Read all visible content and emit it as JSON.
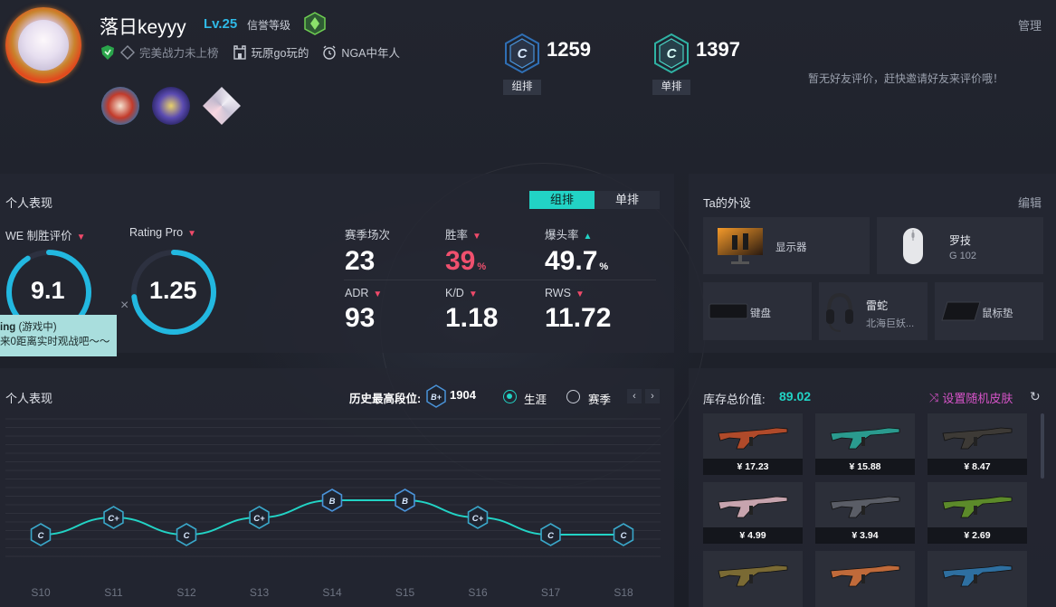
{
  "profile": {
    "username": "落日keyyy",
    "level": "Lv.25",
    "credit_label": "信誉等级",
    "tags": [
      {
        "icon": "shield-green-icon",
        "text": "完美战力未上榜"
      },
      {
        "icon": "fort-icon",
        "text": "玩原go玩的"
      },
      {
        "icon": "alarm-icon",
        "text": "NGA中年人"
      }
    ],
    "badges": [
      "opera-mask-badge",
      "planet-badge",
      "diamond-badge"
    ],
    "manage": "管理",
    "friend_eval": "暂无好友评价，赶快邀请好友来评价哦！"
  },
  "ranks": {
    "group": {
      "grade": "C",
      "score": "1259",
      "tag": "组排"
    },
    "solo": {
      "grade": "C",
      "score": "1397",
      "tag": "单排"
    }
  },
  "performance": {
    "title": "个人表现",
    "tabs": {
      "active": "组排",
      "inactive": "单排"
    },
    "we_label": "WE 制胜评价",
    "we_value": "9.1",
    "we_fraction": 0.91,
    "rating_label": "Rating Pro",
    "rating_value": "1.25",
    "rating_fraction": 0.73,
    "cross": "×",
    "tooltip": {
      "line1_bold": "ing",
      "line1_rest": " (游戏中)",
      "line2": "来0距离实时观战吧～～"
    },
    "stats": [
      {
        "label": "赛季场次",
        "value": "23",
        "unit": "",
        "arrow": ""
      },
      {
        "label": "胜率",
        "value": "39",
        "unit": "%",
        "arrow": "▼"
      },
      {
        "label": "爆头率",
        "value": "49.7",
        "unit": "%",
        "arrow": "▲"
      },
      {
        "label": "ADR",
        "value": "93",
        "unit": "",
        "arrow": "▼"
      },
      {
        "label": "K/D",
        "value": "1.18",
        "unit": "",
        "arrow": "▼"
      },
      {
        "label": "RWS",
        "value": "11.72",
        "unit": "",
        "arrow": "▼"
      }
    ]
  },
  "gear": {
    "title": "Ta的外设",
    "edit": "编辑",
    "items": {
      "monitor": {
        "name": "显示器"
      },
      "mouse": {
        "name": "罗技",
        "sub": "G 102"
      },
      "keyboard": {
        "name": "键盘"
      },
      "headset": {
        "name": "雷蛇",
        "sub": "北海巨妖..."
      },
      "mousepad": {
        "name": "鼠标垫"
      }
    }
  },
  "history": {
    "title": "个人表现",
    "high_label": "历史最高段位:",
    "high_grade": "B+",
    "high_score": "1904",
    "radio_career": "生涯",
    "radio_season": "赛季",
    "prev": "‹",
    "next": "›"
  },
  "chart_data": {
    "type": "line",
    "categories": [
      "S10",
      "S11",
      "S12",
      "S13",
      "S14",
      "S15",
      "S16",
      "S17",
      "S18"
    ],
    "grades": [
      "C",
      "C+",
      "C",
      "C+",
      "B",
      "B",
      "C+",
      "C",
      "C"
    ],
    "values": [
      1,
      2,
      1,
      2,
      3,
      3,
      2,
      1,
      1
    ],
    "ylim": [
      0,
      8
    ],
    "line_color": "#22d3c5"
  },
  "inventory": {
    "label": "库存总价值:",
    "value": "89.02",
    "random_skin": "设置随机皮肤",
    "skins": [
      {
        "price": "¥ 17.23",
        "color": "#b04a2a"
      },
      {
        "price": "¥ 15.88",
        "color": "#2a9a8e"
      },
      {
        "price": "¥ 8.47",
        "color": "#3d3a36"
      },
      {
        "price": "¥ 4.99",
        "color": "#c7a4ae"
      },
      {
        "price": "¥ 3.94",
        "color": "#5a5d66"
      },
      {
        "price": "¥ 2.69",
        "color": "#5c8a2a"
      },
      {
        "price": "",
        "color": "#7a6a34"
      },
      {
        "price": "",
        "color": "#c06a3a"
      },
      {
        "price": "",
        "color": "#2e6fa0"
      }
    ]
  }
}
